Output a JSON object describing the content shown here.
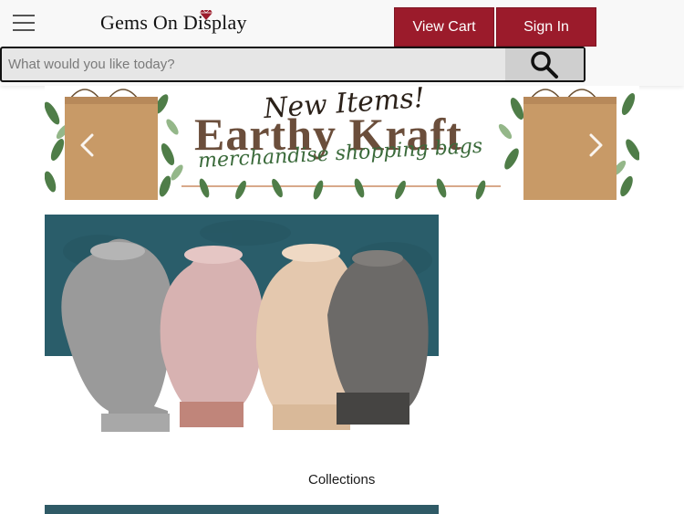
{
  "header": {
    "logo_text": "Gems On Display",
    "view_cart_label": "View Cart",
    "sign_in_label": "Sign In"
  },
  "search": {
    "placeholder": "What would you like today?",
    "value": ""
  },
  "banner": {
    "line1": "New Items!",
    "line2": "Earthy Kraft",
    "line3": "merchandise shopping bags"
  },
  "collection": {
    "caption": "Collections"
  },
  "colors": {
    "brand": "#9b1b2b",
    "search_bg": "#e6e6e6",
    "header_bg": "#f8f8f8"
  },
  "icons": {
    "menu": "hamburger-icon",
    "search": "magnifier-icon",
    "logo_gem": "diamond-icon",
    "prev": "chevron-left-icon",
    "next": "chevron-right-icon"
  }
}
